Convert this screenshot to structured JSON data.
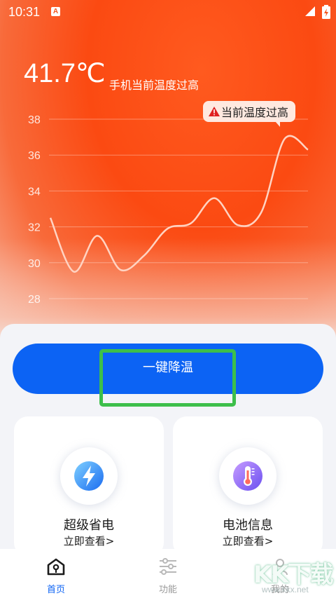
{
  "status_bar": {
    "time": "10:31",
    "notification_badge": "A"
  },
  "header": {
    "temperature": "41.7℃",
    "status_text": "手机当前温度过高"
  },
  "chart_data": {
    "type": "line",
    "x": [
      0,
      1,
      2,
      3,
      4,
      5,
      6,
      7,
      8,
      9,
      10,
      11,
      12,
      13,
      14,
      15
    ],
    "values": [
      32.5,
      29.5,
      31.5,
      29.6,
      30.4,
      31.9,
      32.2,
      33.6,
      32.1,
      32.8,
      36.9,
      36.3
    ],
    "y_ticks": [
      "38",
      "36",
      "34",
      "32",
      "30",
      "28"
    ],
    "ylim": [
      28,
      38
    ],
    "grid": true,
    "annotation": "当前温度过高",
    "line_color": "#ffd3c2"
  },
  "main": {
    "cool_button_label": "一键降温"
  },
  "cards": [
    {
      "title": "超级省电",
      "link": "立即查看>",
      "icon": "lightning-icon"
    },
    {
      "title": "电池信息",
      "link": "立即查看>",
      "icon": "thermometer-icon"
    }
  ],
  "tabs": [
    {
      "label": "首页",
      "icon": "home-icon",
      "active": true
    },
    {
      "label": "功能",
      "icon": "sliders-icon",
      "active": false
    },
    {
      "label": "我的",
      "icon": "user-icon",
      "active": false
    }
  ],
  "watermark": {
    "text": "KK下载",
    "url": "www.kkx.net"
  },
  "colors": {
    "accent": "#0c63f4",
    "hero": "#fb4a12",
    "highlight": "#3dbf4b"
  }
}
